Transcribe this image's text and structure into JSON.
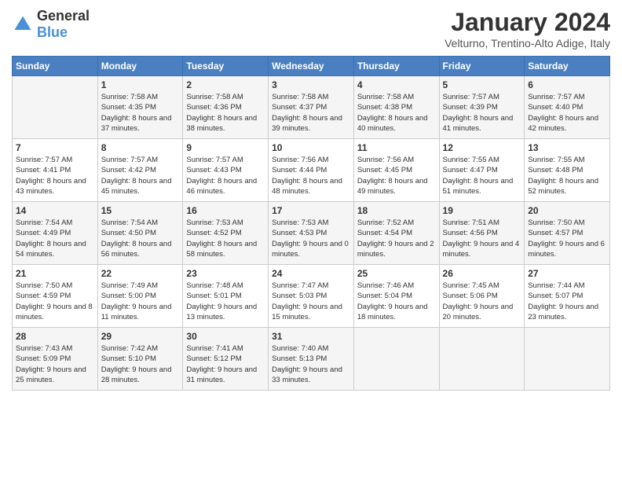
{
  "header": {
    "logo_general": "General",
    "logo_blue": "Blue",
    "month_title": "January 2024",
    "location": "Velturno, Trentino-Alto Adige, Italy"
  },
  "weekdays": [
    "Sunday",
    "Monday",
    "Tuesday",
    "Wednesday",
    "Thursday",
    "Friday",
    "Saturday"
  ],
  "weeks": [
    [
      {
        "day": "",
        "sunrise": "",
        "sunset": "",
        "daylight": ""
      },
      {
        "day": "1",
        "sunrise": "Sunrise: 7:58 AM",
        "sunset": "Sunset: 4:35 PM",
        "daylight": "Daylight: 8 hours and 37 minutes."
      },
      {
        "day": "2",
        "sunrise": "Sunrise: 7:58 AM",
        "sunset": "Sunset: 4:36 PM",
        "daylight": "Daylight: 8 hours and 38 minutes."
      },
      {
        "day": "3",
        "sunrise": "Sunrise: 7:58 AM",
        "sunset": "Sunset: 4:37 PM",
        "daylight": "Daylight: 8 hours and 39 minutes."
      },
      {
        "day": "4",
        "sunrise": "Sunrise: 7:58 AM",
        "sunset": "Sunset: 4:38 PM",
        "daylight": "Daylight: 8 hours and 40 minutes."
      },
      {
        "day": "5",
        "sunrise": "Sunrise: 7:57 AM",
        "sunset": "Sunset: 4:39 PM",
        "daylight": "Daylight: 8 hours and 41 minutes."
      },
      {
        "day": "6",
        "sunrise": "Sunrise: 7:57 AM",
        "sunset": "Sunset: 4:40 PM",
        "daylight": "Daylight: 8 hours and 42 minutes."
      }
    ],
    [
      {
        "day": "7",
        "sunrise": "Sunrise: 7:57 AM",
        "sunset": "Sunset: 4:41 PM",
        "daylight": "Daylight: 8 hours and 43 minutes."
      },
      {
        "day": "8",
        "sunrise": "Sunrise: 7:57 AM",
        "sunset": "Sunset: 4:42 PM",
        "daylight": "Daylight: 8 hours and 45 minutes."
      },
      {
        "day": "9",
        "sunrise": "Sunrise: 7:57 AM",
        "sunset": "Sunset: 4:43 PM",
        "daylight": "Daylight: 8 hours and 46 minutes."
      },
      {
        "day": "10",
        "sunrise": "Sunrise: 7:56 AM",
        "sunset": "Sunset: 4:44 PM",
        "daylight": "Daylight: 8 hours and 48 minutes."
      },
      {
        "day": "11",
        "sunrise": "Sunrise: 7:56 AM",
        "sunset": "Sunset: 4:45 PM",
        "daylight": "Daylight: 8 hours and 49 minutes."
      },
      {
        "day": "12",
        "sunrise": "Sunrise: 7:55 AM",
        "sunset": "Sunset: 4:47 PM",
        "daylight": "Daylight: 8 hours and 51 minutes."
      },
      {
        "day": "13",
        "sunrise": "Sunrise: 7:55 AM",
        "sunset": "Sunset: 4:48 PM",
        "daylight": "Daylight: 8 hours and 52 minutes."
      }
    ],
    [
      {
        "day": "14",
        "sunrise": "Sunrise: 7:54 AM",
        "sunset": "Sunset: 4:49 PM",
        "daylight": "Daylight: 8 hours and 54 minutes."
      },
      {
        "day": "15",
        "sunrise": "Sunrise: 7:54 AM",
        "sunset": "Sunset: 4:50 PM",
        "daylight": "Daylight: 8 hours and 56 minutes."
      },
      {
        "day": "16",
        "sunrise": "Sunrise: 7:53 AM",
        "sunset": "Sunset: 4:52 PM",
        "daylight": "Daylight: 8 hours and 58 minutes."
      },
      {
        "day": "17",
        "sunrise": "Sunrise: 7:53 AM",
        "sunset": "Sunset: 4:53 PM",
        "daylight": "Daylight: 9 hours and 0 minutes."
      },
      {
        "day": "18",
        "sunrise": "Sunrise: 7:52 AM",
        "sunset": "Sunset: 4:54 PM",
        "daylight": "Daylight: 9 hours and 2 minutes."
      },
      {
        "day": "19",
        "sunrise": "Sunrise: 7:51 AM",
        "sunset": "Sunset: 4:56 PM",
        "daylight": "Daylight: 9 hours and 4 minutes."
      },
      {
        "day": "20",
        "sunrise": "Sunrise: 7:50 AM",
        "sunset": "Sunset: 4:57 PM",
        "daylight": "Daylight: 9 hours and 6 minutes."
      }
    ],
    [
      {
        "day": "21",
        "sunrise": "Sunrise: 7:50 AM",
        "sunset": "Sunset: 4:59 PM",
        "daylight": "Daylight: 9 hours and 8 minutes."
      },
      {
        "day": "22",
        "sunrise": "Sunrise: 7:49 AM",
        "sunset": "Sunset: 5:00 PM",
        "daylight": "Daylight: 9 hours and 11 minutes."
      },
      {
        "day": "23",
        "sunrise": "Sunrise: 7:48 AM",
        "sunset": "Sunset: 5:01 PM",
        "daylight": "Daylight: 9 hours and 13 minutes."
      },
      {
        "day": "24",
        "sunrise": "Sunrise: 7:47 AM",
        "sunset": "Sunset: 5:03 PM",
        "daylight": "Daylight: 9 hours and 15 minutes."
      },
      {
        "day": "25",
        "sunrise": "Sunrise: 7:46 AM",
        "sunset": "Sunset: 5:04 PM",
        "daylight": "Daylight: 9 hours and 18 minutes."
      },
      {
        "day": "26",
        "sunrise": "Sunrise: 7:45 AM",
        "sunset": "Sunset: 5:06 PM",
        "daylight": "Daylight: 9 hours and 20 minutes."
      },
      {
        "day": "27",
        "sunrise": "Sunrise: 7:44 AM",
        "sunset": "Sunset: 5:07 PM",
        "daylight": "Daylight: 9 hours and 23 minutes."
      }
    ],
    [
      {
        "day": "28",
        "sunrise": "Sunrise: 7:43 AM",
        "sunset": "Sunset: 5:09 PM",
        "daylight": "Daylight: 9 hours and 25 minutes."
      },
      {
        "day": "29",
        "sunrise": "Sunrise: 7:42 AM",
        "sunset": "Sunset: 5:10 PM",
        "daylight": "Daylight: 9 hours and 28 minutes."
      },
      {
        "day": "30",
        "sunrise": "Sunrise: 7:41 AM",
        "sunset": "Sunset: 5:12 PM",
        "daylight": "Daylight: 9 hours and 31 minutes."
      },
      {
        "day": "31",
        "sunrise": "Sunrise: 7:40 AM",
        "sunset": "Sunset: 5:13 PM",
        "daylight": "Daylight: 9 hours and 33 minutes."
      },
      {
        "day": "",
        "sunrise": "",
        "sunset": "",
        "daylight": ""
      },
      {
        "day": "",
        "sunrise": "",
        "sunset": "",
        "daylight": ""
      },
      {
        "day": "",
        "sunrise": "",
        "sunset": "",
        "daylight": ""
      }
    ]
  ]
}
